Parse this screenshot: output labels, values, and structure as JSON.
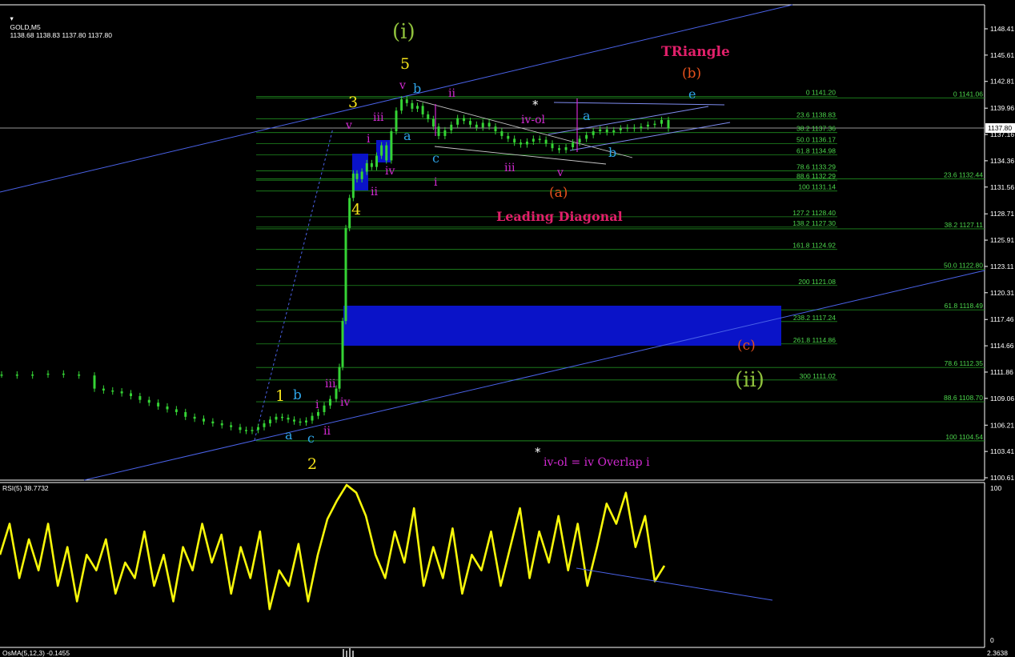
{
  "header": {
    "symbol": "GOLD,M5",
    "ohlc": "1138.68 1138.83 1137.80 1137.80"
  },
  "current_price": "1137.80",
  "price_axis": [
    "1148.41",
    "1145.61",
    "1142.81",
    "1139.96",
    "1137.16",
    "1134.36",
    "1131.56",
    "1128.71",
    "1125.91",
    "1123.11",
    "1120.31",
    "1117.46",
    "1114.66",
    "1111.86",
    "1109.06",
    "1106.21",
    "1103.41",
    "1100.61"
  ],
  "fib_right": [
    "0 1141.06",
    "23.6 1132.44",
    "38.2 1127.11",
    "50.0 1122.80",
    "61.8 1118.49",
    "78.6 1112.35",
    "88.6 1108.70",
    "100 1104.54"
  ],
  "fib_left": [
    "0 1141.20",
    "23.6 1138.83",
    "38.2 1137.36",
    "50.0 1136.17",
    "61.8 1134.98",
    "78.6 1133.29",
    "88.6 1132.29",
    "100 1131.14",
    "127.2 1128.40",
    "138.2 1127.30",
    "161.8 1124.92",
    "200 1121.08",
    "238.2 1117.24",
    "261.8 1114.86",
    "300 1111.02"
  ],
  "wave_labels": {
    "w_i": "(i)",
    "w_ii": "(ii)",
    "w5": "5",
    "w3": "3",
    "w4": "4",
    "w1": "1",
    "w2": "2",
    "tri_title": "TRiangle",
    "b_paren": "(b)",
    "a_paren": "(a)",
    "c_paren": "(c)",
    "leading_diag": "Leading Diagonal",
    "iv_ol": "iv-ol",
    "iv_ol_note": "iv-ol = iv Overlap i",
    "star": "*",
    "sm_v": "v",
    "sm_b": "b",
    "sm_ii": "ii",
    "sm_iii": "iii",
    "sm_i": "i",
    "sm_a": "a",
    "sm_iv": "iv",
    "sm_c": "c",
    "sm_e": "e"
  },
  "indicators": {
    "rsi_label": "RSI(5) 38.7732",
    "rsi_max": "100",
    "rsi_min": "0",
    "osma_label": "OsMA(5,12,3) -0.1455",
    "osma_value": "2.3638"
  },
  "colors": {
    "candle": "#35d335",
    "channel": "#4a62e8",
    "fib": "#1f8a1f",
    "zone": "#0a13c8",
    "rsi": "#f7f70a",
    "yellow": "#f5e21a",
    "cyan": "#2ea4e8",
    "magenta": "#d22ad2",
    "green_lbl": "#8fc03c",
    "orange": "#e8511c",
    "pink": "#e0206a"
  },
  "chart_data": {
    "type": "candlestick",
    "title": "GOLD,M5",
    "ylim": [
      1100.61,
      1148.41
    ],
    "series": [
      {
        "name": "GOLD,M5",
        "values": [
          1111.6,
          1111.5,
          1111.6,
          1111.7,
          1111.6,
          1111.5,
          1110.1,
          1109.9,
          1109.8,
          1109.6,
          1109.3,
          1108.9,
          1108.6,
          1108.2,
          1107.9,
          1107.6,
          1107.1,
          1106.9,
          1106.6,
          1106.4,
          1106.2,
          1106.0,
          1105.7,
          1105.6,
          1105.7,
          1106.0,
          1106.4,
          1106.8,
          1107.1,
          1107.0,
          1106.8,
          1106.6,
          1106.5,
          1106.7,
          1107.2,
          1107.6,
          1108.3,
          1109.0,
          1110.1,
          1112.4,
          1117.3,
          1127.2,
          1130.4,
          1133.0,
          1132.4,
          1133.2,
          1134.1,
          1133.7,
          1134.9,
          1136.0,
          1134.4,
          1137.5,
          1139.7,
          1140.9,
          1140.5,
          1139.9,
          1140.2,
          1139.3,
          1138.8,
          1138.0,
          1137.0,
          1137.6,
          1138.2,
          1138.9,
          1138.6,
          1138.2,
          1137.9,
          1138.4,
          1138.0,
          1137.5,
          1137.0,
          1136.7,
          1136.3,
          1136.1,
          1136.4,
          1136.7,
          1136.6,
          1136.2,
          1135.7,
          1135.5,
          1135.8,
          1136.3,
          1136.7,
          1137.1,
          1137.5,
          1137.7,
          1137.4,
          1137.6,
          1137.8,
          1137.9,
          1137.8,
          1138.0,
          1138.2,
          1138.3,
          1138.7,
          1137.8
        ]
      },
      {
        "name": "RSI(5)",
        "values": [
          55,
          75,
          40,
          65,
          45,
          75,
          35,
          60,
          25,
          55,
          45,
          65,
          30,
          50,
          40,
          70,
          35,
          55,
          25,
          60,
          45,
          75,
          50,
          68,
          30,
          60,
          40,
          70,
          20,
          45,
          35,
          62,
          25,
          55,
          78,
          90,
          100,
          95,
          80,
          55,
          40,
          70,
          50,
          85,
          35,
          60,
          40,
          72,
          30,
          55,
          45,
          70,
          35,
          60,
          85,
          40,
          70,
          50,
          80,
          45,
          75,
          35,
          60,
          88,
          75,
          95,
          60,
          80,
          38,
          48
        ]
      }
    ]
  }
}
